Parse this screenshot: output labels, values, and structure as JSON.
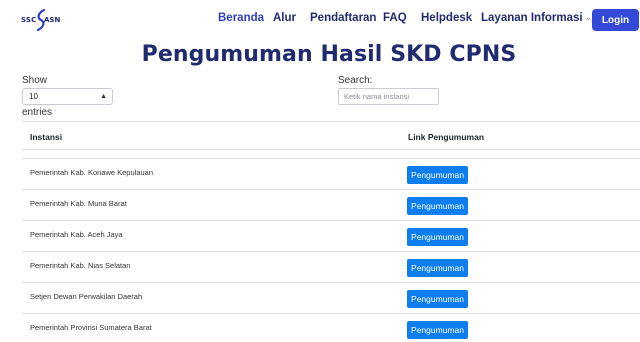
{
  "brand": {
    "logo_text_left": "SSC",
    "logo_text_right": "ASN",
    "accent": "#1f2b6e",
    "primary": "#3549d8",
    "button_blue": "#0d7ef0"
  },
  "nav": {
    "items": [
      {
        "label": "Beranda",
        "active": true
      },
      {
        "label": "Alur"
      },
      {
        "label": "Pendaftaran"
      },
      {
        "label": "FAQ"
      },
      {
        "label": "Helpdesk"
      },
      {
        "label": "Layanan Informasi",
        "has_dropdown": true
      }
    ],
    "login_label": "Login"
  },
  "page": {
    "title": "Pengumuman Hasil SKD CPNS"
  },
  "controls": {
    "show_label": "Show",
    "entries_value": "10",
    "entries_label": "entries",
    "search_label": "Search:",
    "search_placeholder": "Ketik nama instansi"
  },
  "table": {
    "columns": [
      "Instansi",
      "Link Pengumuman"
    ],
    "rows": [
      {
        "instansi": "Pemerintah Kab. Konawe Kepulauan",
        "link_label": "Pengumuman"
      },
      {
        "instansi": "Pemerintah Kab. Muna Barat",
        "link_label": "Pengumuman"
      },
      {
        "instansi": "Pemerintah Kab. Aceh Jaya",
        "link_label": "Pengumuman"
      },
      {
        "instansi": "Pemerintah Kab. Nias Selatan",
        "link_label": "Pengumuman"
      },
      {
        "instansi": "Setjen Dewan Perwakilan Daerah",
        "link_label": "Pengumuman"
      },
      {
        "instansi": "Pemerintah Provinsi Sumatera Barat",
        "link_label": "Pengumuman"
      }
    ]
  }
}
